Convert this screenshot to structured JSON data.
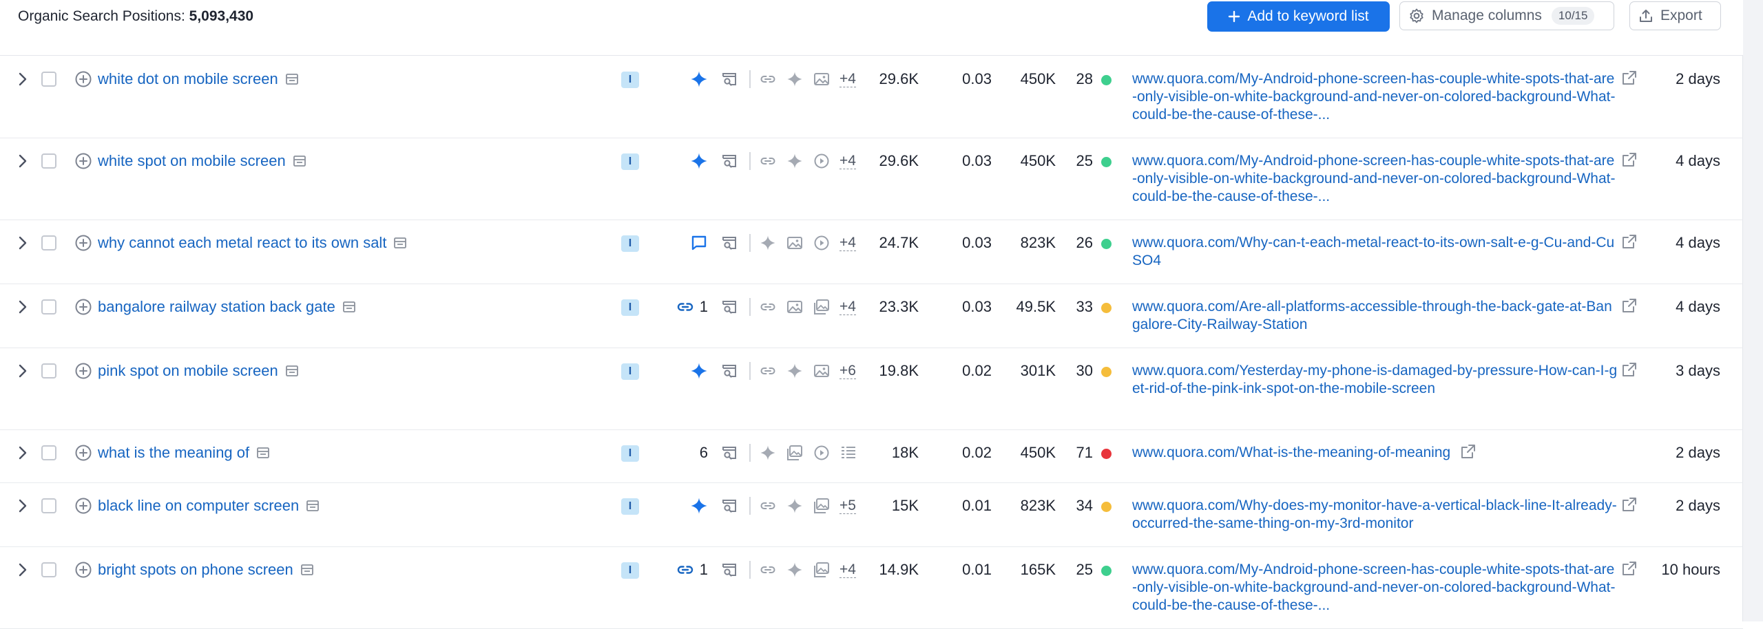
{
  "header": {
    "title_label": "Organic Search Positions:",
    "title_count": "5,093,430",
    "add_button": "Add to keyword list",
    "manage_button": "Manage columns",
    "manage_count": "10/15",
    "export_button": "Export"
  },
  "colors": {
    "accent": "#1a73e8",
    "link": "#1765c1",
    "green": "#3ecf8e",
    "yellow": "#f5bd3b",
    "red": "#e8353c"
  },
  "rows": [
    {
      "keyword": "white dot on mobile screen",
      "intent": "I",
      "rank_icon": "ai-sparkle-icon",
      "rank": "",
      "features": [
        "link-icon",
        "sparkle-icon",
        "image-icon"
      ],
      "more": "+4",
      "volume": "29.6K",
      "kd": "0.03",
      "cpc": "450K",
      "comp": "28",
      "dot": "green",
      "url": "www.quora.com/My-Android-phone-screen-has-couple-white-spots-that-are-only-visible-on-white-background-and-never-on-colored-background-What-could-be-the-cause-of-these-...",
      "updated": "2 days"
    },
    {
      "keyword": "white spot on mobile screen",
      "intent": "I",
      "rank_icon": "ai-sparkle-icon",
      "rank": "",
      "features": [
        "link-icon",
        "sparkle-icon",
        "video-icon"
      ],
      "more": "+4",
      "volume": "29.6K",
      "kd": "0.03",
      "cpc": "450K",
      "comp": "25",
      "dot": "green",
      "url": "www.quora.com/My-Android-phone-screen-has-couple-white-spots-that-are-only-visible-on-white-background-and-never-on-colored-background-What-could-be-the-cause-of-these-...",
      "updated": "4 days"
    },
    {
      "keyword": "why cannot each metal react to its own salt",
      "intent": "I",
      "rank_icon": "chat-icon",
      "rank": "",
      "features": [
        "sparkle-icon",
        "image-icon",
        "video-icon"
      ],
      "more": "+4",
      "volume": "24.7K",
      "kd": "0.03",
      "cpc": "823K",
      "comp": "26",
      "dot": "green",
      "url": "www.quora.com/Why-can-t-each-metal-react-to-its-own-salt-e-g-Cu-and-CuSO4",
      "updated": "4 days"
    },
    {
      "keyword": "bangalore railway station back gate",
      "intent": "I",
      "rank_icon": "link-icon",
      "rank": "1",
      "features": [
        "link-icon",
        "image-icon",
        "images-icon"
      ],
      "more": "+4",
      "volume": "23.3K",
      "kd": "0.03",
      "cpc": "49.5K",
      "comp": "33",
      "dot": "yellow",
      "url": "www.quora.com/Are-all-platforms-accessible-through-the-back-gate-at-Bangalore-City-Railway-Station",
      "updated": "4 days"
    },
    {
      "keyword": "pink spot on mobile screen",
      "intent": "I",
      "rank_icon": "ai-sparkle-icon",
      "rank": "",
      "features": [
        "link-icon",
        "sparkle-icon",
        "image-icon"
      ],
      "more": "+6",
      "volume": "19.8K",
      "kd": "0.02",
      "cpc": "301K",
      "comp": "30",
      "dot": "yellow",
      "url": "www.quora.com/Yesterday-my-phone-is-damaged-by-pressure-How-can-I-get-rid-of-the-pink-ink-spot-on-the-mobile-screen",
      "updated": "3 days"
    },
    {
      "keyword": "what is the meaning of",
      "intent": "I",
      "rank_icon": "",
      "rank": "6",
      "features": [
        "sparkle-icon",
        "images-icon",
        "video-icon",
        "list-icon"
      ],
      "more": "",
      "volume": "18K",
      "kd": "0.02",
      "cpc": "450K",
      "comp": "71",
      "dot": "red",
      "url": "www.quora.com/What-is-the-meaning-of-meaning",
      "updated": "2 days"
    },
    {
      "keyword": "black line on computer screen",
      "intent": "I",
      "rank_icon": "ai-sparkle-icon",
      "rank": "",
      "features": [
        "link-icon",
        "sparkle-icon",
        "images-icon"
      ],
      "more": "+5",
      "volume": "15K",
      "kd": "0.01",
      "cpc": "823K",
      "comp": "34",
      "dot": "yellow",
      "url": "www.quora.com/Why-does-my-monitor-have-a-vertical-black-line-It-already-occurred-the-same-thing-on-my-3rd-monitor",
      "updated": "2 days"
    },
    {
      "keyword": "bright spots on phone screen",
      "intent": "I",
      "rank_icon": "link-icon",
      "rank": "1",
      "features": [
        "link-icon",
        "sparkle-icon",
        "images-icon"
      ],
      "more": "+4",
      "volume": "14.9K",
      "kd": "0.01",
      "cpc": "165K",
      "comp": "25",
      "dot": "green",
      "url": "www.quora.com/My-Android-phone-screen-has-couple-white-spots-that-are-only-visible-on-white-background-and-never-on-colored-background-What-could-be-the-cause-of-these-...",
      "updated": "10 hours"
    }
  ]
}
